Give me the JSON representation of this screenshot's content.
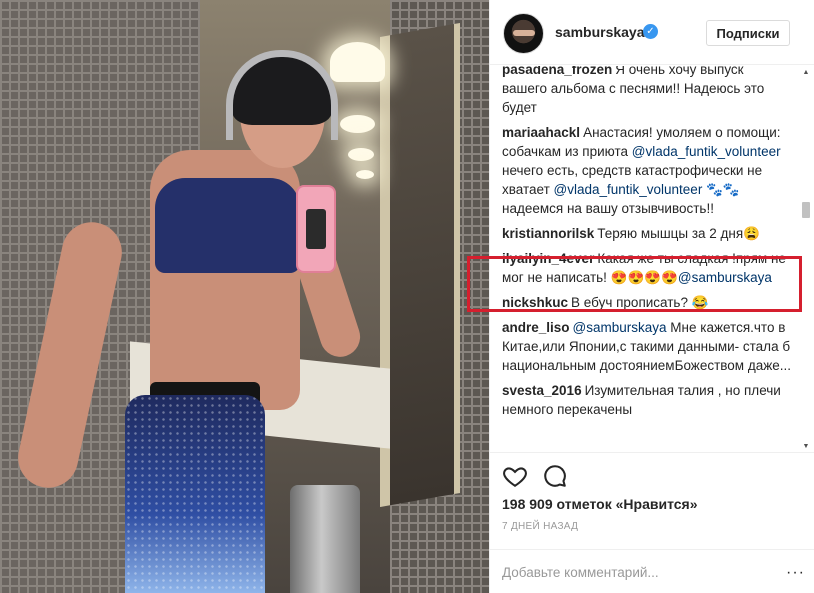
{
  "header": {
    "username": "samburskaya",
    "verified_glyph": "✓",
    "follow_label": "Подписки"
  },
  "comments": [
    {
      "user": "pasadena_frozen",
      "text": "Я очень хочу выпуск вашего альбома с песнями!! Надеюсь это будет"
    },
    {
      "user": "mariaahackl",
      "text_parts": [
        "Анастасия! умоляем о помощи: собачкам из приюта ",
        "@vlada_funtik_volunteer",
        " нечего есть, средств катастрофически не хватает ",
        "@vlada_funtik_volunteer",
        " 🐾🐾 надеемся на вашу отзывчивость!!"
      ]
    },
    {
      "user": "kristiannorilsk",
      "text": "Теряю мышцы за 2 дня😩"
    },
    {
      "user": "ilyailyin_4ever",
      "text": "Какая же ты сладкая !прям не мог не написать! 😍😍😍😍",
      "mention": "@samburskaya",
      "highlighted": true
    },
    {
      "user": "nickshkuc",
      "text": "В ебуч прописать? 😂"
    },
    {
      "user": "andre_liso",
      "mention": "@samburskaya",
      "text": "Мне кажется.что в Китае,или Японии,с такими данными- стала б национальным достояниемБожеством даже..."
    },
    {
      "user": "svesta_2016",
      "text": "Изумительная талия , но плечи немного перекачены"
    }
  ],
  "actions": {
    "like_icon": "heart-icon",
    "comment_icon": "comment-bubble-icon",
    "likes_text": "198 909 отметок «Нравится»",
    "timestamp": "7 ДНЕЙ НАЗАД"
  },
  "add_comment": {
    "placeholder": "Добавьте комментарий...",
    "more_label": "···"
  },
  "scrollbar": {
    "up_glyph": "▲",
    "down_glyph": "▼"
  },
  "colors": {
    "highlight_border": "#d51f2e",
    "verified_blue": "#3897f0",
    "mention_blue": "#003569"
  }
}
